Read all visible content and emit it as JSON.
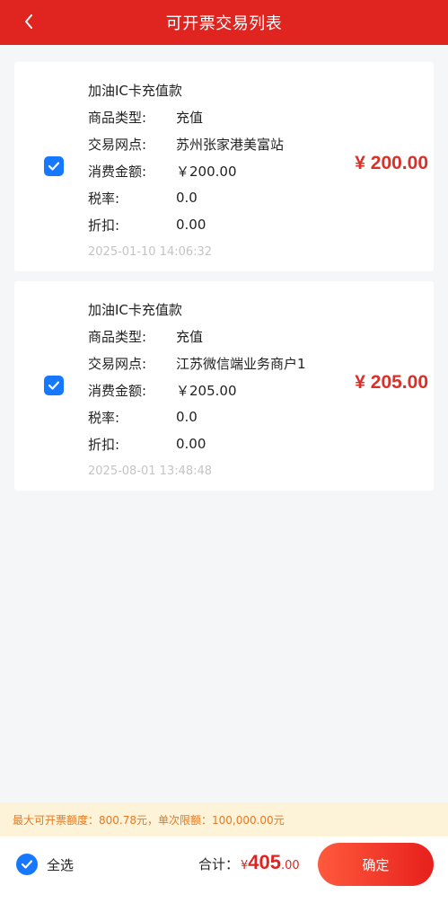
{
  "header": {
    "title": "可开票交易列表",
    "back_icon": "chevron-left-icon"
  },
  "labels": {
    "product_type": "商品类型:",
    "outlet": "交易网点:",
    "amount": "消费金额:",
    "tax_rate": "税率:",
    "discount": "折扣:"
  },
  "transactions": [
    {
      "checked": true,
      "title": "加油IC卡充值款",
      "product_type": "充值",
      "outlet": "苏州张家港美富站",
      "amount": "￥200.00",
      "tax_rate": "0.0",
      "discount": "0.00",
      "time": "2025-01-10 14:06:32",
      "big_amount": "¥ 200.00"
    },
    {
      "checked": true,
      "title": "加油IC卡充值款",
      "product_type": "充值",
      "outlet": "江苏微信端业务商户1",
      "amount": "￥205.00",
      "tax_rate": "0.0",
      "discount": "0.00",
      "time": "2025-08-01 13:48:48",
      "big_amount": "¥ 205.00"
    }
  ],
  "notice": "最大可开票额度：800.78元，单次限额：100,000.00元",
  "footer": {
    "select_all_label": "全选",
    "select_all_checked": true,
    "total_label": "合计：",
    "total_currency": "¥",
    "total_int": "405",
    "total_dec": ".00",
    "confirm_label": "确定"
  },
  "colors": {
    "brand_red": "#e0241f",
    "check_blue": "#1677ff",
    "notice_bg": "#fdf3d8",
    "notice_text": "#e77921"
  }
}
